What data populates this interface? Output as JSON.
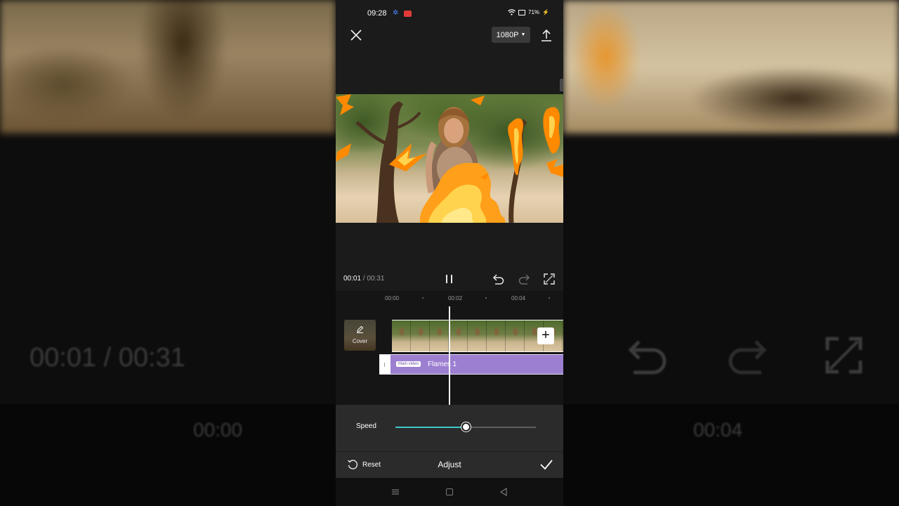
{
  "status_bar": {
    "time": "09:28",
    "battery": "71%"
  },
  "top_bar": {
    "resolution": "1080P"
  },
  "playback": {
    "current_time": "00:01",
    "separator": " / ",
    "total_time": "00:31"
  },
  "timeline": {
    "ruler": [
      "00:00",
      "00:02",
      "00:04"
    ],
    "cover_label": "Cover",
    "effect": {
      "tag": "Main video",
      "name": "Flames 1",
      "color": "#9c7fd0"
    }
  },
  "speed": {
    "label": "Speed",
    "value_fraction": 0.5,
    "accent": "#3ec8c8"
  },
  "bottom_bar": {
    "reset_label": "Reset",
    "title": "Adjust"
  },
  "background": {
    "time": "00:01 / 00:31",
    "ruler_left": "00:00",
    "ruler_right": "00:04"
  }
}
